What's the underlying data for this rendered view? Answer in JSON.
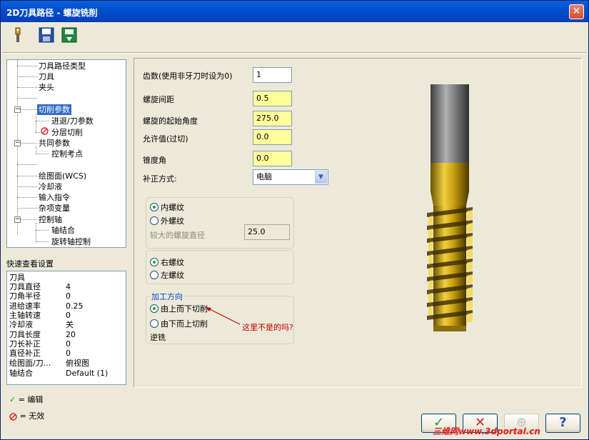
{
  "window": {
    "title": "2D刀具路径 - 螺旋铣削",
    "close_glyph": "✕"
  },
  "toolbar": {
    "icons": [
      "tool-icon",
      "save-icon",
      "export-icon"
    ]
  },
  "tree": {
    "items": [
      {
        "label": "刀具路径类型"
      },
      {
        "label": "刀具"
      },
      {
        "label": "夹头"
      },
      {
        "label": "切削参数"
      },
      {
        "label": "进退/刀参数"
      },
      {
        "label": "分层切削"
      },
      {
        "label": "共同参数"
      },
      {
        "label": "控制考点"
      },
      {
        "label": "绘图面(WCS)"
      },
      {
        "label": "冷却液"
      },
      {
        "label": "输入指令"
      },
      {
        "label": "杂项变量"
      },
      {
        "label": "控制轴"
      },
      {
        "label": "轴结合"
      },
      {
        "label": "旋转轴控制"
      }
    ]
  },
  "quick_view": {
    "title": "快速查看设置",
    "rows": [
      {
        "k": "刀具",
        "v": ""
      },
      {
        "k": "刀具直径",
        "v": "4"
      },
      {
        "k": "刀角半径",
        "v": "0"
      },
      {
        "k": "进给速率",
        "v": "0.25"
      },
      {
        "k": "主轴转速",
        "v": "0"
      },
      {
        "k": "冷却液",
        "v": "关"
      },
      {
        "k": "刀具长度",
        "v": "20"
      },
      {
        "k": "刀长补正",
        "v": "0"
      },
      {
        "k": "直径补正",
        "v": "0"
      },
      {
        "k": "绘图面/刀...",
        "v": "俯视图"
      },
      {
        "k": "轴结合",
        "v": "Default (1)"
      }
    ]
  },
  "legend": {
    "edit": "= 编辑",
    "invalid": "= 无效"
  },
  "params": {
    "teeth_label": "齿数(使用非牙刀时设为0)",
    "teeth_value": "1",
    "pitch_label": "螺旋间距",
    "pitch_value": "0.5",
    "start_angle_label": "螺旋的起始角度",
    "start_angle_value": "275.0",
    "allowance_label": "允许值(过切)",
    "allowance_value": "0.0",
    "taper_label": "锥度角",
    "taper_value": "0.0",
    "comp_label": "补正方式:",
    "comp_value": "电脑"
  },
  "thread_type": {
    "internal": "内螺纹",
    "external": "外螺纹",
    "major_dia_label": "较大的螺旋直径",
    "major_dia_value": "25.0"
  },
  "hand": {
    "right": "右螺纹",
    "left": "左螺纹"
  },
  "direction": {
    "title": "加工方向",
    "top_down": "由上而下切削",
    "bottom_up": "由下而上切削",
    "climb": "逆铣"
  },
  "annotation": "这里不是的吗?",
  "watermark": "三维网www.3dportal.cn",
  "colors": {
    "title_bar": "#0a5fd8",
    "selected": "#316ac5",
    "input_yellow": "#ffff9c",
    "annotation": "#c00000"
  }
}
